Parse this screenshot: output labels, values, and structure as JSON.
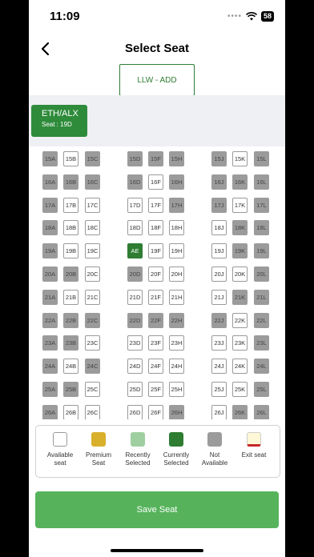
{
  "status": {
    "time": "11:09",
    "battery": "58"
  },
  "header": {
    "title": "Select Seat",
    "leg_tab": "LLW - ADD"
  },
  "passenger": {
    "name": "ETH/ALX",
    "seat": "Seat : 19D"
  },
  "seat_map": {
    "rows": [
      {
        "row": "15",
        "seats": [
          [
            "15A",
            "na"
          ],
          [
            "15B",
            "av"
          ],
          [
            "15C",
            "na"
          ],
          [
            "15D",
            "na"
          ],
          [
            "15F",
            "na"
          ],
          [
            "15H",
            "na"
          ],
          [
            "15J",
            "na"
          ],
          [
            "15K",
            "av"
          ],
          [
            "15L",
            "na"
          ]
        ]
      },
      {
        "row": "16",
        "seats": [
          [
            "16A",
            "na"
          ],
          [
            "16B",
            "na"
          ],
          [
            "16C",
            "na"
          ],
          [
            "16D",
            "na"
          ],
          [
            "16F",
            "av"
          ],
          [
            "16H",
            "na"
          ],
          [
            "16J",
            "na"
          ],
          [
            "16K",
            "na"
          ],
          [
            "16L",
            "na"
          ]
        ]
      },
      {
        "row": "17",
        "seats": [
          [
            "17A",
            "na"
          ],
          [
            "17B",
            "av"
          ],
          [
            "17C",
            "av"
          ],
          [
            "17D",
            "av"
          ],
          [
            "17F",
            "av"
          ],
          [
            "17H",
            "na"
          ],
          [
            "17J",
            "na"
          ],
          [
            "17K",
            "av"
          ],
          [
            "17L",
            "na"
          ]
        ]
      },
      {
        "row": "18",
        "seats": [
          [
            "18A",
            "na"
          ],
          [
            "18B",
            "av"
          ],
          [
            "18C",
            "av"
          ],
          [
            "18D",
            "av"
          ],
          [
            "18F",
            "av"
          ],
          [
            "18H",
            "av"
          ],
          [
            "18J",
            "av"
          ],
          [
            "18K",
            "na"
          ],
          [
            "18L",
            "na"
          ]
        ]
      },
      {
        "row": "19",
        "seats": [
          [
            "19A",
            "na"
          ],
          [
            "19B",
            "av"
          ],
          [
            "19C",
            "av"
          ],
          [
            "AE",
            "cs"
          ],
          [
            "19F",
            "av"
          ],
          [
            "19H",
            "av"
          ],
          [
            "19J",
            "av"
          ],
          [
            "19K",
            "na"
          ],
          [
            "19L",
            "na"
          ]
        ]
      },
      {
        "row": "20",
        "seats": [
          [
            "20A",
            "na"
          ],
          [
            "20B",
            "na"
          ],
          [
            "20C",
            "av"
          ],
          [
            "20D",
            "na"
          ],
          [
            "20F",
            "av"
          ],
          [
            "20H",
            "av"
          ],
          [
            "20J",
            "av"
          ],
          [
            "20K",
            "av"
          ],
          [
            "20L",
            "na"
          ]
        ]
      },
      {
        "row": "21",
        "seats": [
          [
            "21A",
            "na"
          ],
          [
            "21B",
            "av"
          ],
          [
            "21C",
            "av"
          ],
          [
            "21D",
            "av"
          ],
          [
            "21F",
            "av"
          ],
          [
            "21H",
            "av"
          ],
          [
            "21J",
            "av"
          ],
          [
            "21K",
            "na"
          ],
          [
            "21L",
            "na"
          ]
        ]
      },
      {
        "row": "22",
        "seats": [
          [
            "22A",
            "na"
          ],
          [
            "22B",
            "na"
          ],
          [
            "22C",
            "na"
          ],
          [
            "22D",
            "na"
          ],
          [
            "22F",
            "na"
          ],
          [
            "22H",
            "na"
          ],
          [
            "22J",
            "na"
          ],
          [
            "22K",
            "av"
          ],
          [
            "22L",
            "na"
          ]
        ]
      },
      {
        "row": "23",
        "seats": [
          [
            "23A",
            "na"
          ],
          [
            "23B",
            "na"
          ],
          [
            "23C",
            "av"
          ],
          [
            "23D",
            "av"
          ],
          [
            "23F",
            "av"
          ],
          [
            "23H",
            "av"
          ],
          [
            "23J",
            "av"
          ],
          [
            "23K",
            "av"
          ],
          [
            "23L",
            "na"
          ]
        ]
      },
      {
        "row": "24",
        "seats": [
          [
            "24A",
            "na"
          ],
          [
            "24B",
            "av"
          ],
          [
            "24C",
            "na"
          ],
          [
            "24D",
            "av"
          ],
          [
            "24F",
            "av"
          ],
          [
            "24H",
            "av"
          ],
          [
            "24J",
            "av"
          ],
          [
            "24K",
            "av"
          ],
          [
            "24L",
            "na"
          ]
        ]
      },
      {
        "row": "25",
        "seats": [
          [
            "25A",
            "na"
          ],
          [
            "25B",
            "na"
          ],
          [
            "25C",
            "av"
          ],
          [
            "25D",
            "av"
          ],
          [
            "25F",
            "av"
          ],
          [
            "25H",
            "av"
          ],
          [
            "25J",
            "av"
          ],
          [
            "25K",
            "av"
          ],
          [
            "25L",
            "na"
          ]
        ]
      },
      {
        "row": "26",
        "seats": [
          [
            "26A",
            "na"
          ],
          [
            "26B",
            "av"
          ],
          [
            "26C",
            "av"
          ],
          [
            "26D",
            "av"
          ],
          [
            "26F",
            "av"
          ],
          [
            "26H",
            "na"
          ],
          [
            "26J",
            "av"
          ],
          [
            "26K",
            "na"
          ],
          [
            "26L",
            "na"
          ]
        ]
      }
    ]
  },
  "legend": [
    {
      "label": "Available\nseat",
      "color": "#ffffff",
      "border": "#9a9a9a"
    },
    {
      "label": "Premium\nSeat",
      "color": "#d9b02c",
      "border": "#d9b02c"
    },
    {
      "label": "Recently\nSelected",
      "color": "#9fcfa0",
      "border": "#9fcfa0"
    },
    {
      "label": "Currently\nSelected",
      "color": "#2e7d32",
      "border": "#2e7d32"
    },
    {
      "label": "Not\nAvailable",
      "color": "#9b9b9b",
      "border": "#9b9b9b"
    },
    {
      "label": "Exit seat",
      "color": "#fff8d6",
      "border": "#c62828"
    }
  ],
  "save_label": "Save Seat"
}
